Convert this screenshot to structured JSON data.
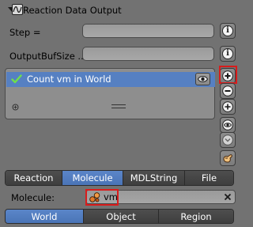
{
  "panel": {
    "title": "Reaction Data Output"
  },
  "fields": {
    "step_label": "Step =",
    "step_value": "",
    "output_buf_label": "OutputBufSize ...",
    "output_buf_value": ""
  },
  "list": {
    "items": [
      {
        "label": "Count vm in World",
        "checked": true,
        "selected": true
      }
    ]
  },
  "side_buttons": [
    "add",
    "remove",
    "add-circle",
    "eye",
    "chevron-down",
    "wand"
  ],
  "tabs": {
    "items": [
      {
        "label": "Reaction",
        "active": false
      },
      {
        "label": "Molecule",
        "active": true
      },
      {
        "label": "MDLString",
        "active": false
      },
      {
        "label": "File",
        "active": false
      }
    ]
  },
  "molecule": {
    "label": "Molecule:",
    "value": "vm"
  },
  "scope_tabs": {
    "items": [
      {
        "label": "World",
        "active": true
      },
      {
        "label": "Object",
        "active": false
      },
      {
        "label": "Region",
        "active": false
      }
    ]
  },
  "colors": {
    "background": "#727272",
    "selection": "#5680c2",
    "highlight": "#d91c1c"
  }
}
